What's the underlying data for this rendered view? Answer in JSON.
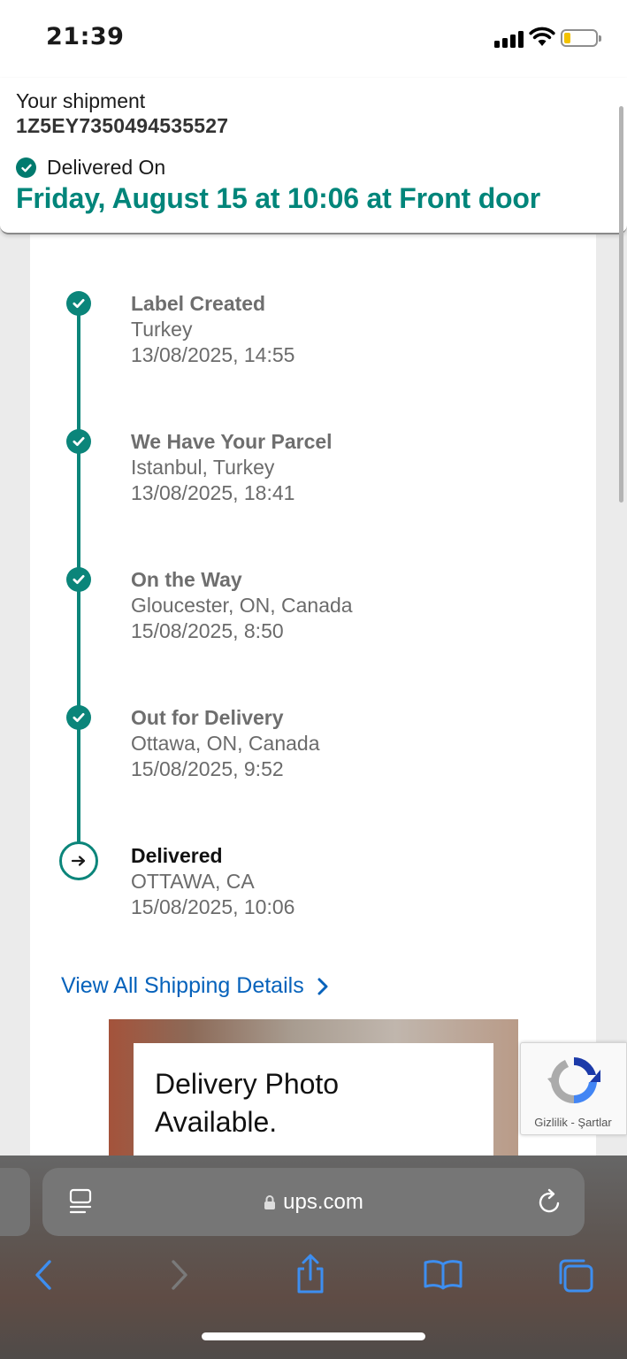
{
  "status_bar": {
    "time": "21:39"
  },
  "header": {
    "label": "Your shipment",
    "tracking_number": "1Z5EY7350494535527",
    "status_label": "Delivered On",
    "delivered_detail": "Friday, August 15 at 10:06 at Front door"
  },
  "timeline": [
    {
      "title": "Label Created",
      "location": "Turkey",
      "datetime": "13/08/2025, 14:55",
      "state": "done"
    },
    {
      "title": "We Have Your Parcel",
      "location": "Istanbul, Turkey",
      "datetime": "13/08/2025, 18:41",
      "state": "done"
    },
    {
      "title": "On the Way",
      "location": "Gloucester, ON, Canada",
      "datetime": "15/08/2025, 8:50",
      "state": "done"
    },
    {
      "title": "Out for Delivery",
      "location": "Ottawa, ON, Canada",
      "datetime": "15/08/2025, 9:52",
      "state": "done"
    },
    {
      "title": "Delivered",
      "location": "OTTAWA, CA",
      "datetime": "15/08/2025, 10:06",
      "state": "current"
    }
  ],
  "view_all_link": "View All Shipping Details",
  "delivery_photo": {
    "text": "Delivery Photo Available."
  },
  "recaptcha": {
    "links": "Gizlilik - Şartlar"
  },
  "browser": {
    "url": "ups.com",
    "toolbar_icons": [
      "back-icon",
      "forward-icon",
      "share-icon",
      "bookmarks-icon",
      "tabs-icon"
    ]
  },
  "colors": {
    "accent": "#00857a",
    "link": "#0662bb",
    "battery_low": "#f2c200"
  }
}
